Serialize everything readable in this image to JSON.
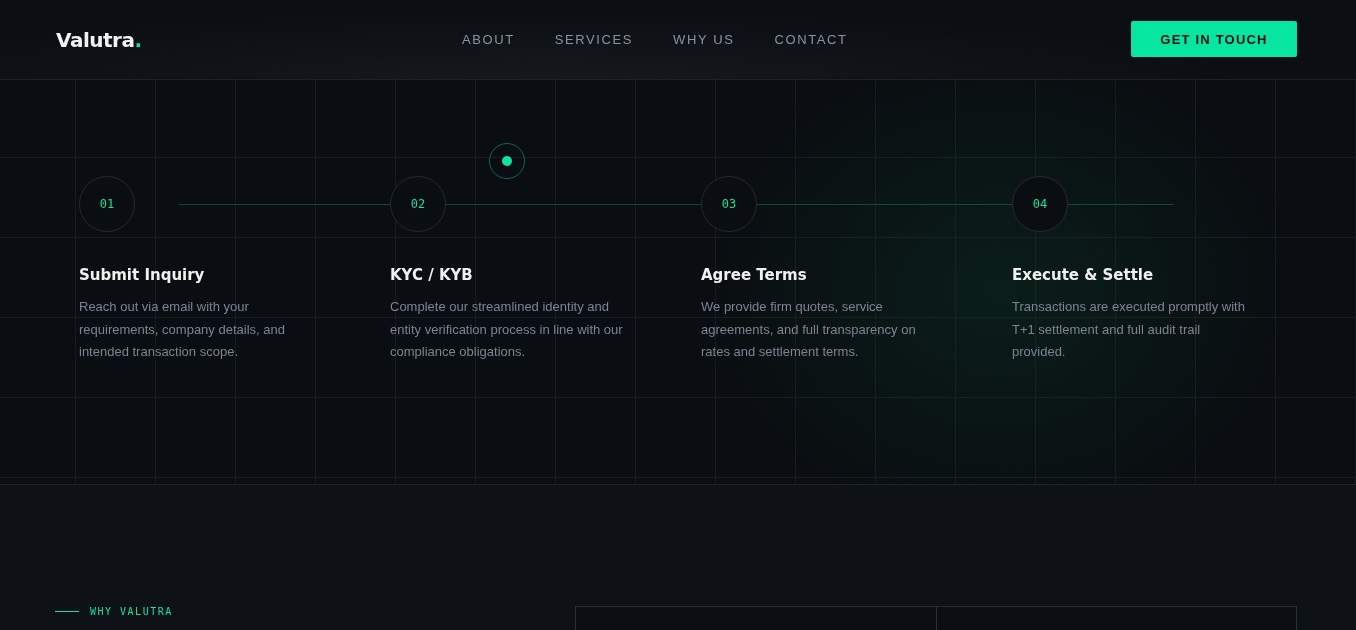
{
  "header": {
    "logo": {
      "name": "Valutra",
      "mark": "."
    },
    "nav": [
      {
        "label": "ABOUT"
      },
      {
        "label": "SERVICES"
      },
      {
        "label": "WHY US"
      },
      {
        "label": "CONTACT"
      }
    ],
    "cta": "GET IN TOUCH"
  },
  "how_it_works": {
    "steps": [
      {
        "number": "01",
        "title": "Submit Inquiry",
        "text": "Reach out via email with your requirements, company details, and intended transaction scope."
      },
      {
        "number": "02",
        "title": "KYC / KYB",
        "text": "Complete our streamlined identity and entity verification process in line with our compliance obligations."
      },
      {
        "number": "03",
        "title": "Agree Terms",
        "text": "We provide firm quotes, service agreements, and full transparency on rates and settlement terms."
      },
      {
        "number": "04",
        "title": "Execute & Settle",
        "text": "Transactions are executed promptly with T+1 settlement and full audit trail provided."
      }
    ]
  },
  "why": {
    "eyebrow": "WHY VALUTRA"
  }
}
